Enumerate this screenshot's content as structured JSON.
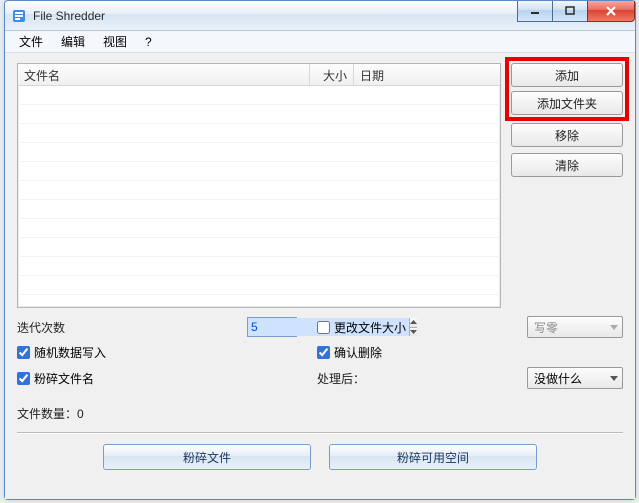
{
  "title": "File Shredder",
  "menu": {
    "file": "文件",
    "edit": "编辑",
    "view": "视图",
    "help": "?"
  },
  "columns": {
    "name": "文件名",
    "size": "大小",
    "date": "日期"
  },
  "side": {
    "add": "添加",
    "add_folder": "添加文件夹",
    "remove": "移除",
    "clear": "清除"
  },
  "opts": {
    "iterations_label": "迭代次数",
    "iterations_value": "5",
    "change_size": "更改文件大小",
    "overwrite_method_select": "写零",
    "random_write": "随机数据写入",
    "confirm_delete": "确认删除",
    "shred_name": "粉碎文件名",
    "after_label": "处理后：",
    "after_select": "没做什么"
  },
  "file_count_label": "文件数量：0",
  "bottom": {
    "shred_files": "粉碎文件",
    "shred_freespace": "粉碎可用空间"
  }
}
